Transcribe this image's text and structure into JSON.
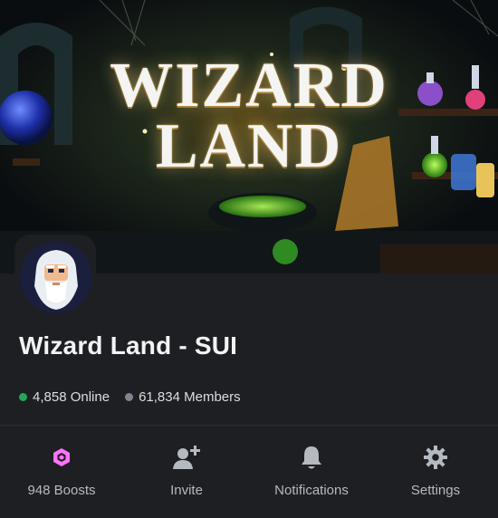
{
  "banner": {
    "title_line1": "WIZARD",
    "title_line2": "LAND"
  },
  "server": {
    "name": "Wizard Land - SUI",
    "online_count": "4,858 Online",
    "members_count": "61,834 Members"
  },
  "actions": [
    {
      "label": "948 Boosts",
      "icon": "boost-icon"
    },
    {
      "label": "Invite",
      "icon": "add-user-icon"
    },
    {
      "label": "Notifications",
      "icon": "bell-icon"
    },
    {
      "label": "Settings",
      "icon": "gear-icon"
    }
  ],
  "colors": {
    "background": "#1e1f22",
    "online_dot": "#23a55a",
    "members_dot": "#80848e",
    "boost": "#ff73fa",
    "icon": "#b5bac1"
  }
}
